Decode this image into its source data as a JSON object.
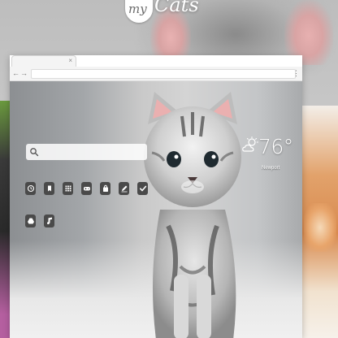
{
  "logo": {
    "prefix": "my",
    "name": "Cats"
  },
  "browser": {
    "tab_close": "×",
    "back": "←",
    "forward": "→",
    "menu": "⋮"
  },
  "search": {
    "value": "",
    "placeholder": ""
  },
  "app_icons": [
    {
      "name": "history-icon"
    },
    {
      "name": "bookmark-icon"
    },
    {
      "name": "apps-grid-icon"
    },
    {
      "name": "gamepad-icon"
    },
    {
      "name": "store-bag-icon"
    },
    {
      "name": "edit-pen-icon"
    },
    {
      "name": "check-icon"
    },
    {
      "name": "drive-icon"
    },
    {
      "name": "music-note-icon"
    }
  ],
  "weather": {
    "icon": "partly-cloudy-icon",
    "temperature": "76°",
    "city": "Newport"
  },
  "colors": {
    "icon_bg": "#4a4a4a",
    "accent_white": "#ffffff"
  }
}
